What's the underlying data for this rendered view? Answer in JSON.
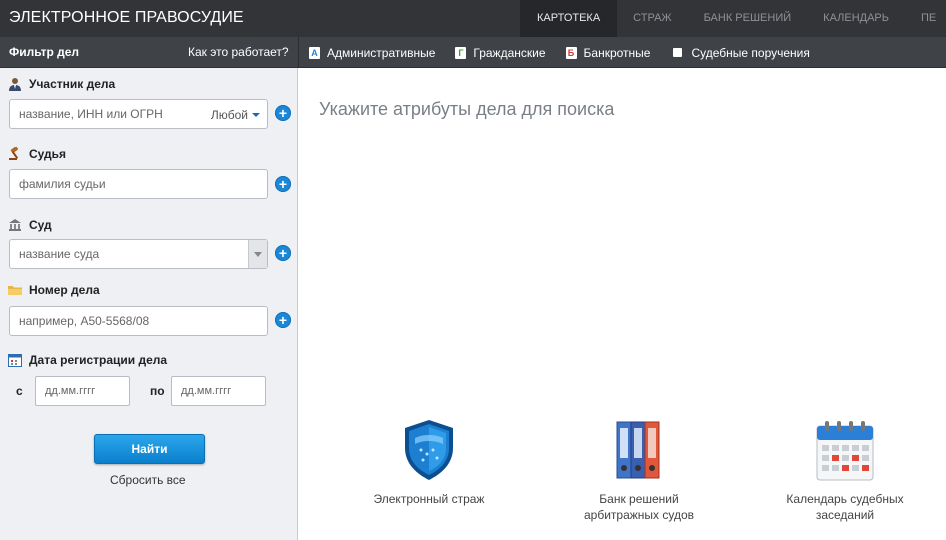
{
  "header": {
    "brand": "ЭЛЕКТРОННОЕ ПРАВОСУДИЕ",
    "tabs": [
      {
        "label": "КАРТОТЕКА",
        "active": true
      },
      {
        "label": "СТРАЖ",
        "active": false
      },
      {
        "label": "БАНК РЕШЕНИЙ",
        "active": false
      },
      {
        "label": "КАЛЕНДАРЬ",
        "active": false
      },
      {
        "label": "ПЕ",
        "active": false
      }
    ]
  },
  "subbar": {
    "filter_title": "Фильтр дел",
    "how_it_works": "Как это работает?",
    "case_types": [
      {
        "letter": "А",
        "label": "Административные",
        "color": "#2b7fd6",
        "icon": "admin-case-icon"
      },
      {
        "letter": "Г",
        "label": "Гражданские",
        "color": "#3aa53a",
        "icon": "civil-case-icon"
      },
      {
        "letter": "Б",
        "label": "Банкротные",
        "color": "#d63b3b",
        "icon": "bankruptcy-case-icon"
      },
      {
        "letter": "",
        "label": "Судебные поручения",
        "color": "#ffffff",
        "icon": "checkbox-icon"
      }
    ]
  },
  "filters": {
    "participant": {
      "label": "Участник дела",
      "placeholder": "название, ИНН или ОГРН",
      "role_value": "Любой",
      "icon": "user-icon"
    },
    "judge": {
      "label": "Судья",
      "placeholder": "фамилия судьи",
      "icon": "gavel-icon"
    },
    "court": {
      "label": "Суд",
      "placeholder": "название суда",
      "icon": "courthouse-icon"
    },
    "case_number": {
      "label": "Номер дела",
      "placeholder": "например, А50-5568/08",
      "icon": "folder-icon"
    },
    "registration_date": {
      "label": "Дата регистрации дела",
      "from_label": "с",
      "to_label": "по",
      "from_placeholder": "дд.мм.гггг",
      "to_placeholder": "дд.мм.гггг",
      "icon": "calendar-icon"
    },
    "add_symbol": "+",
    "find_button": "Найти",
    "reset_link": "Сбросить все"
  },
  "main": {
    "hint": "Укажите атрибуты дела для поиска",
    "tiles": [
      {
        "label_line1": "Электронный страж",
        "label_line2": "",
        "icon": "shield-icon"
      },
      {
        "label_line1": "Банк решений",
        "label_line2": "арбитражных судов",
        "icon": "binders-icon"
      },
      {
        "label_line1": "Календарь судебных",
        "label_line2": "заседаний",
        "icon": "calendar-large-icon"
      }
    ]
  }
}
